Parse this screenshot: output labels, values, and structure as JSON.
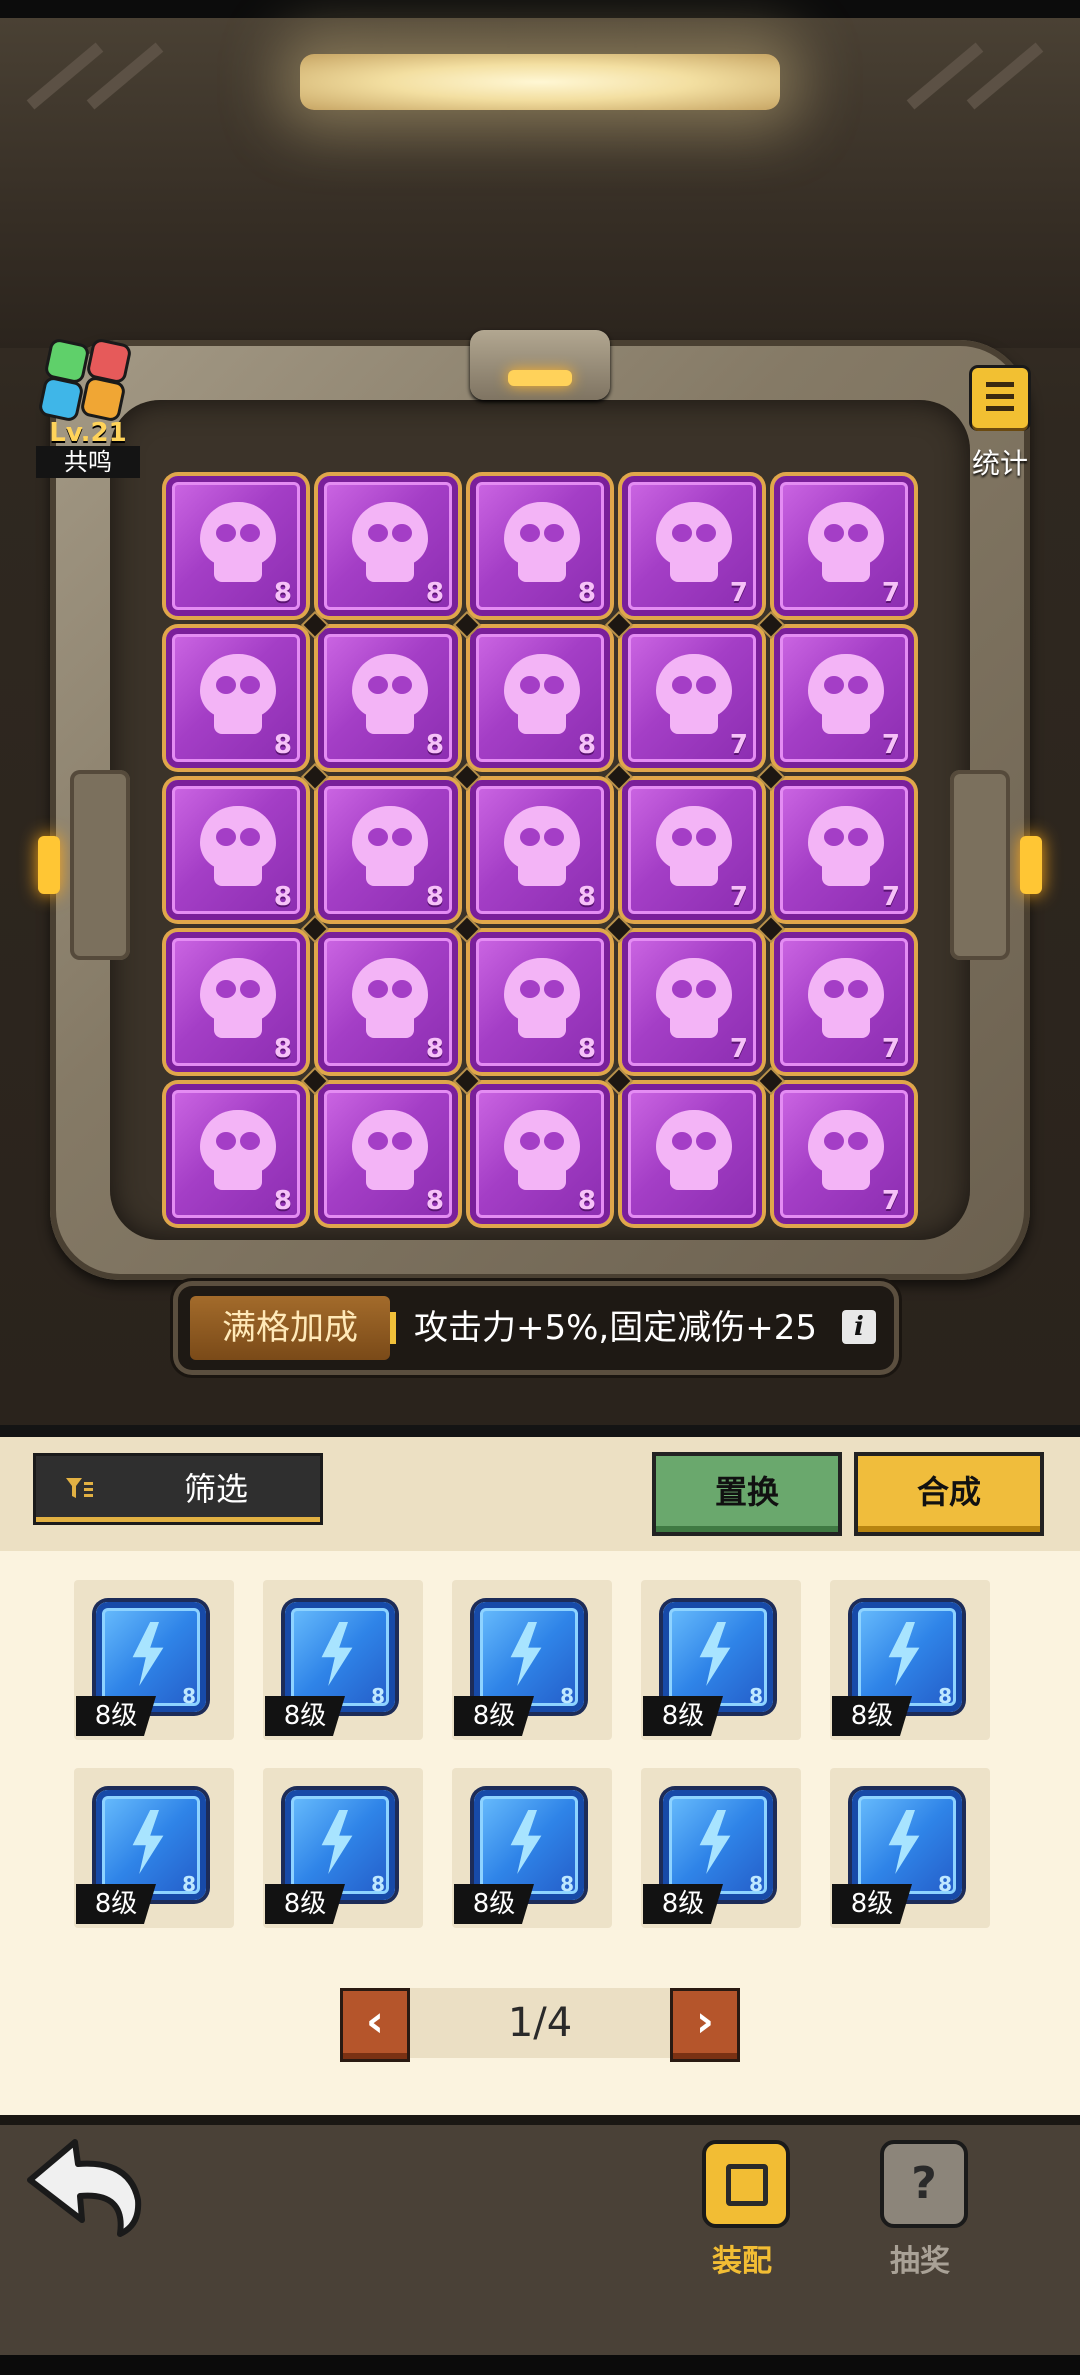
{
  "header": {
    "resonance": {
      "level": "Lv.21",
      "label": "共鸣"
    },
    "stats_label": "统计"
  },
  "grid": {
    "rows": [
      [
        "8",
        "8",
        "8",
        "7",
        "7"
      ],
      [
        "8",
        "8",
        "8",
        "7",
        "7"
      ],
      [
        "8",
        "8",
        "8",
        "7",
        "7"
      ],
      [
        "8",
        "8",
        "8",
        "7",
        "7"
      ],
      [
        "8",
        "8",
        "8",
        "",
        "7"
      ]
    ]
  },
  "bonus": {
    "label": "满格加成",
    "text": "攻击力+5%,固定减伤+25",
    "info_icon": "info-icon"
  },
  "toolbar": {
    "filter_label": "筛选",
    "swap_label": "置换",
    "merge_label": "合成"
  },
  "inventory": {
    "items": [
      {
        "tag": "8级",
        "level": "8"
      },
      {
        "tag": "8级",
        "level": "8"
      },
      {
        "tag": "8级",
        "level": "8"
      },
      {
        "tag": "8级",
        "level": "8"
      },
      {
        "tag": "8级",
        "level": "8"
      },
      {
        "tag": "8级",
        "level": "8"
      },
      {
        "tag": "8级",
        "level": "8"
      },
      {
        "tag": "8级",
        "level": "8"
      },
      {
        "tag": "8级",
        "level": "8"
      },
      {
        "tag": "8级",
        "level": "8"
      }
    ]
  },
  "pager": {
    "text": "1/4",
    "prev_icon": "chevron-left-icon",
    "next_icon": "chevron-right-icon"
  },
  "nav": {
    "equip_label": "装配",
    "lottery_label": "抽奖"
  },
  "colors": {
    "accent": "#f0bd3c",
    "grid_tile": "#a43ec6",
    "chip": "#2f84e8",
    "swap": "#6aa86d"
  }
}
